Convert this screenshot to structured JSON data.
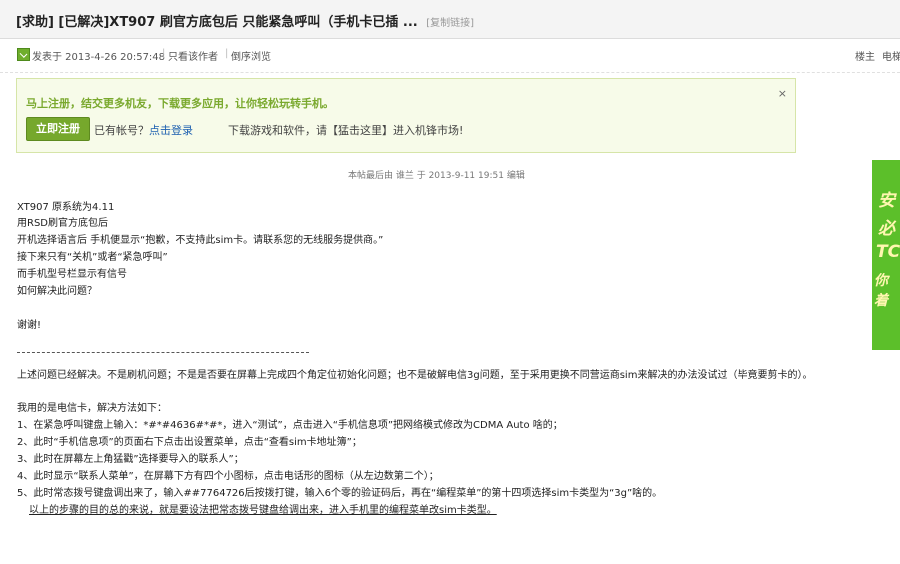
{
  "header": {
    "title": "[求助] [已解决]XT907 刷官方底包后 只能紧急呼叫（手机卡已插 ...",
    "copy_link": "[复制链接]"
  },
  "meta": {
    "posted": "发表于 2013-4-26 20:57:48",
    "author_only": "只看该作者",
    "reverse": "倒序浏览",
    "floor": "楼主",
    "electric": "电梯"
  },
  "notice": {
    "headline": "马上注册，结交更多机友，下载更多应用，让你轻松玩转手机。",
    "register_button": "立即注册",
    "have_account": "已有帐号？",
    "login_link": "点击登录",
    "download_text": "下载游戏和软件，请【猛击这里】进入机锋市场!"
  },
  "edit_note": "本帖最后由 谁兰 于 2013-9-11 19:51 编辑",
  "post_lines": [
    "XT907 原系统为4.11",
    "用RSD刷官方底包后",
    "开机选择语言后 手机便显示“抱歉，不支持此sim卡。请联系您的无线服务提供商。”",
    "接下来只有“关机”或者“紧急呼叫”",
    "而手机型号栏显示有信号",
    "如何解决此问题？"
  ],
  "thanks": "谢谢!",
  "dashes": "-------------------------------------------------------------------",
  "solution_intro": "上述问题已经解决。不是刷机问题；不是是否要在屏幕上完成四个角定位初始化问题；也不是破解电信3g问题，至于采用更换不同营运商sim来解决的办法没试过（毕竟要剪卡的）。",
  "method_title": "我用的是电信卡，解决方法如下：",
  "steps": [
    "1、在紧急呼叫键盘上输入：*#*#4636#*#*，进入“测试”，点击进入“手机信息项”把网络模式修改为CDMA Auto 啥的；",
    "2、此时“手机信息项”的页面右下点击出设置菜单，点击“查看sim卡地址簿”；",
    "3、此时在屏幕左上角猛戳”选择要导入的联系人”；",
    "4、此时显示“联系人菜单”，在屏幕下方有四个小图标，点击电话形的图标（从左边数第二个）；",
    "5、此时常态拨号键盘调出来了，输入##7764726后按拨打键，输入6个零的验证码后，再在“编程菜单”的第十四项选择sim卡类型为“3g”啥的。"
  ],
  "summary": "以上的步骤的目的总的来说，就是要设法把常态拨号键盘给调出来，进入手机里的编程菜单改sim卡类型。",
  "ad": {
    "chars": [
      "安",
      "必",
      "TC",
      "你着"
    ],
    "color": "#5cbf2a"
  }
}
